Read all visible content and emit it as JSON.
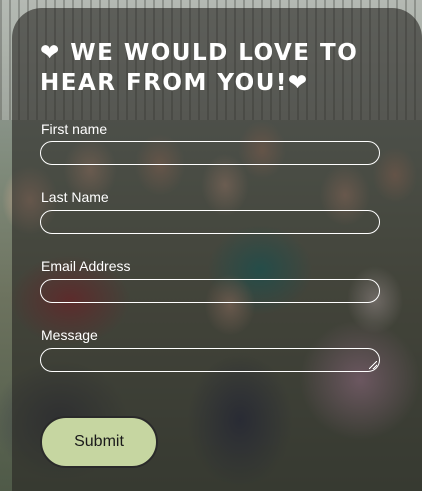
{
  "form": {
    "heading_line1": "WE WOULD LOVE TO",
    "heading_line2": "HEAR FROM YOU!",
    "heart": "❤",
    "first_name": {
      "label": "First name",
      "value": "",
      "placeholder": ""
    },
    "last_name": {
      "label": "Last Name",
      "value": "",
      "placeholder": ""
    },
    "email": {
      "label": "Email Address",
      "value": "",
      "placeholder": ""
    },
    "message": {
      "label": "Message",
      "value": "",
      "placeholder": ""
    },
    "submit_label": "Submit"
  },
  "colors": {
    "overlay": "#28262499",
    "button": "#c6d6a1",
    "text": "#ffffff"
  }
}
